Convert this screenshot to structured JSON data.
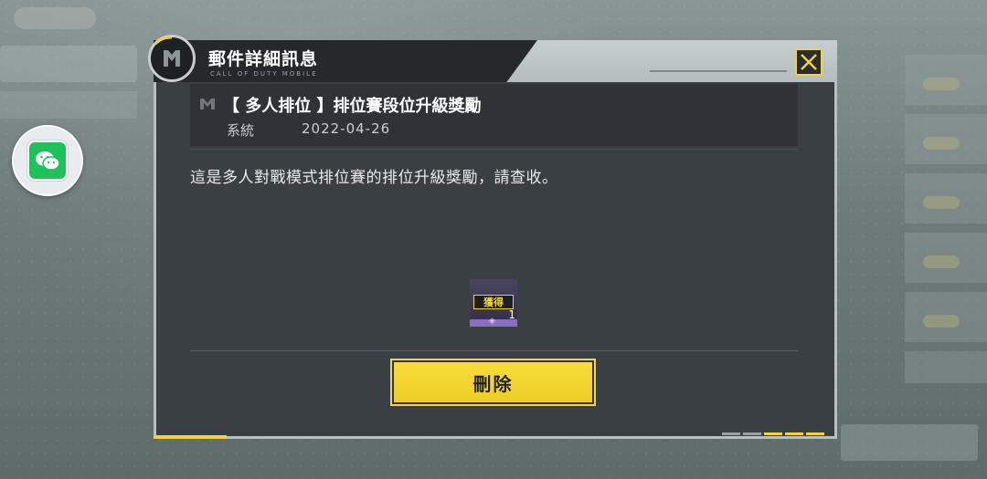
{
  "dialog": {
    "title": "郵件詳細訊息",
    "subtitle": "CALL OF DUTY MOBILE",
    "close_icon": "close-x-icon"
  },
  "mail": {
    "subject": "【 多人排位 】排位賽段位升級獎勵",
    "sender": "系統",
    "date": "2022-04-26",
    "body": "這是多人對戰模式排位賽的排位升級獎勵，請查收。"
  },
  "reward": {
    "badge": "獲得",
    "quantity": "1"
  },
  "actions": {
    "delete_label": "刪除"
  },
  "colors": {
    "accent": "#f2d438",
    "panel": "#3a3f43",
    "wechat": "#1dc35a"
  }
}
